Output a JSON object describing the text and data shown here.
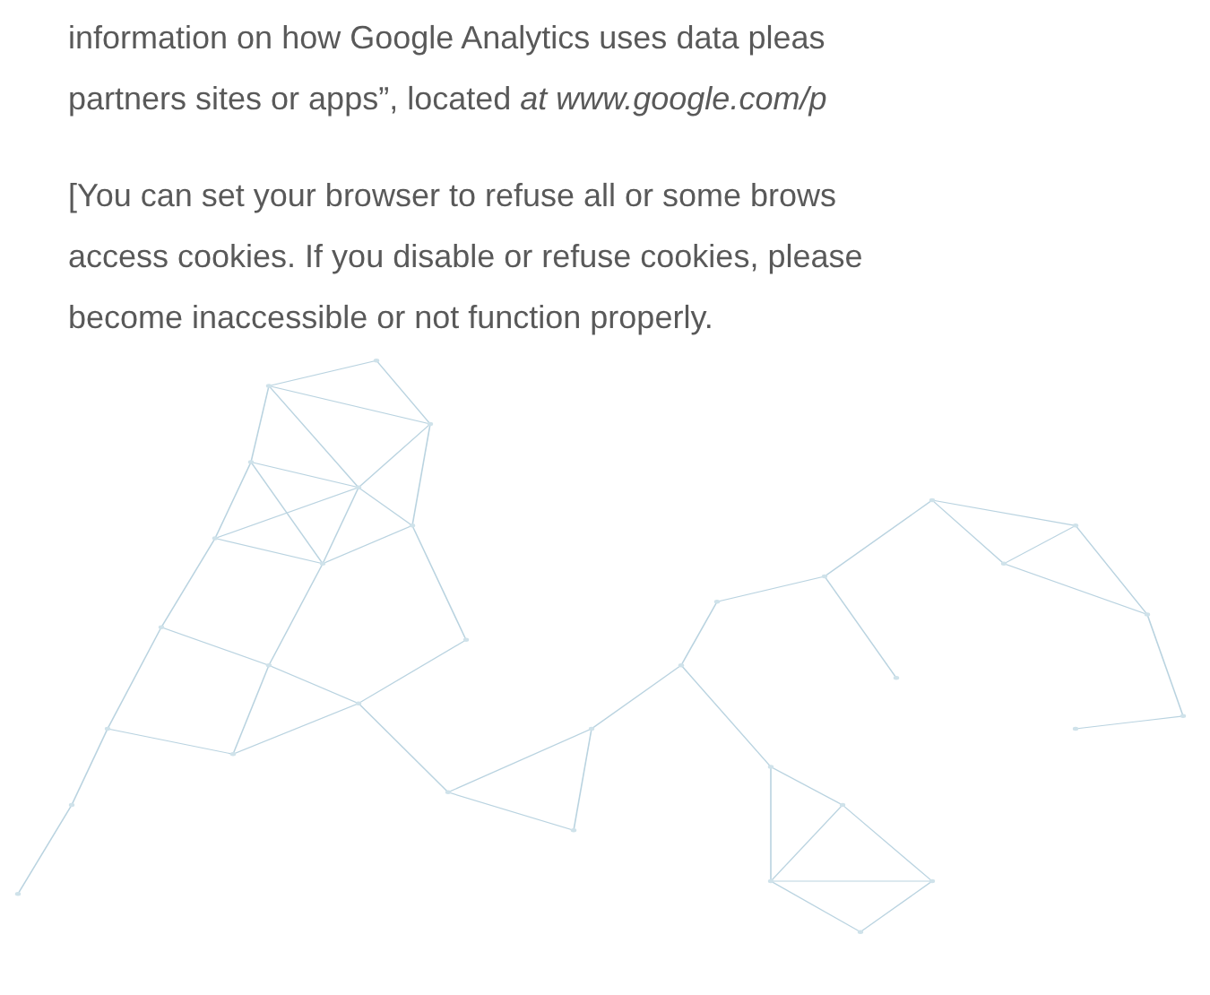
{
  "paragraphs": [
    {
      "lines": [
        "information on how Google Analytics uses data pleas",
        "partners sites or apps”, located *at www.google.com/p*"
      ]
    },
    {
      "lines": [
        "[You can set your browser to refuse all or some brows",
        "access cookies. If you disable or refuse cookies, please",
        "become inaccessible or not function properly."
      ]
    }
  ]
}
